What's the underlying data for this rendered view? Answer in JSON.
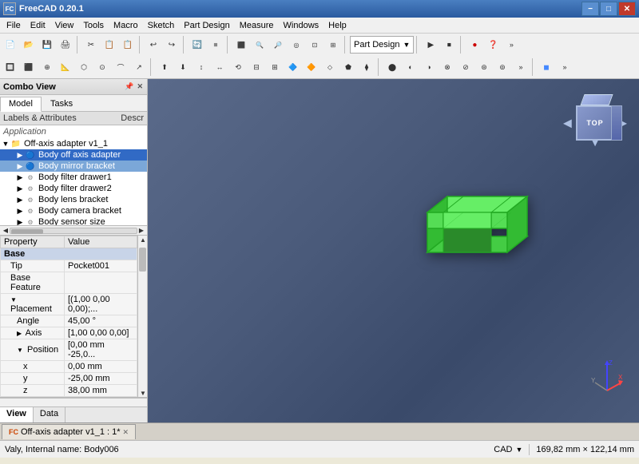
{
  "app": {
    "title": "FreeCAD 0.20.1",
    "icon": "FC"
  },
  "titlebar": {
    "title": "FreeCAD 0.20.1",
    "min": "−",
    "max": "□",
    "close": "✕"
  },
  "menu": {
    "items": [
      "File",
      "Edit",
      "View",
      "Tools",
      "Macro",
      "Sketch",
      "Part Design",
      "Measure",
      "Windows",
      "Help"
    ]
  },
  "combo": {
    "title": "Combo View",
    "pin": "□",
    "close": "✕"
  },
  "tabs": {
    "model": "Model",
    "tasks": "Tasks"
  },
  "tree": {
    "header_label": "Labels & Attributes",
    "header_descr": "Descr",
    "section": "Application",
    "root": "Off-axis adapter v1_1",
    "items": [
      {
        "label": "Body off axis adapter",
        "selected": true,
        "indent": 2
      },
      {
        "label": "Body mirror bracket",
        "selected": true,
        "indent": 2
      },
      {
        "label": "Body filter drawer1",
        "selected": false,
        "indent": 2
      },
      {
        "label": "Body filter drawer2",
        "selected": false,
        "indent": 2
      },
      {
        "label": "Body lens bracket",
        "selected": false,
        "indent": 2
      },
      {
        "label": "Body camera bracket",
        "selected": false,
        "indent": 2
      },
      {
        "label": "Body sensor size",
        "selected": false,
        "indent": 2
      }
    ]
  },
  "properties": {
    "col1": "Property",
    "col2": "Value",
    "section": "Base",
    "rows": [
      {
        "prop": "Tip",
        "value": "Pocket001",
        "indent": 1
      },
      {
        "prop": "Base Feature",
        "value": "",
        "indent": 1
      },
      {
        "prop": "Placement",
        "value": "[(1,00 0,00 0,00);...",
        "indent": 1,
        "expand": true
      },
      {
        "prop": "Angle",
        "value": "45,00 °",
        "indent": 2
      },
      {
        "prop": "Axis",
        "value": "[1,00 0,00 0,00]",
        "indent": 2,
        "expand": false
      },
      {
        "prop": "Position",
        "value": "[0,00 mm -25,0...",
        "indent": 2,
        "expand": true
      },
      {
        "prop": "x",
        "value": "0,00 mm",
        "indent": 3
      },
      {
        "prop": "y",
        "value": "-25,00 mm",
        "indent": 3
      },
      {
        "prop": "z",
        "value": "38,00 mm",
        "indent": 3
      }
    ]
  },
  "bottomTabs": {
    "view": "View",
    "data": "Data"
  },
  "viewportTab": {
    "label": "Off-axis adapter v1_1 : 1*",
    "icon": "FC",
    "close": "✕"
  },
  "statusbar": {
    "left": "Valy, Internal name: Body006",
    "cad": "CAD",
    "dimensions": "169,82 mm × 122,14 mm"
  },
  "navCube": {
    "top_label": "TOP"
  },
  "partDesignDropdown": "Part Design",
  "toolbar": {
    "icons": [
      "🆕",
      "📂",
      "💾",
      "🖨",
      "✂",
      "📋",
      "📋",
      "↩",
      "↪",
      "⬛",
      "🔍",
      "🔍",
      "⬜",
      "🔄",
      "🔵",
      "▶",
      "⏩",
      "⏹",
      "⏺",
      "⬛",
      "🔴",
      "❓"
    ]
  }
}
